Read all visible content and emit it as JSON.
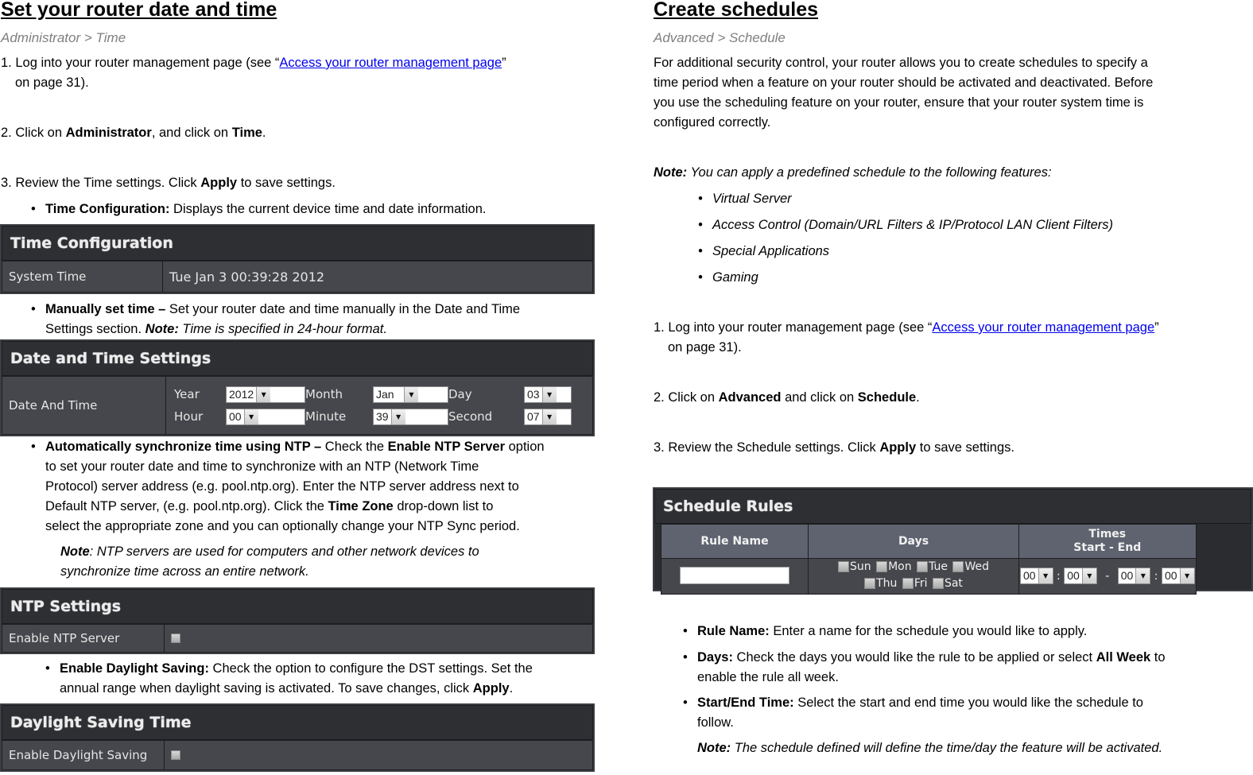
{
  "left": {
    "title": "Set your router date and time",
    "breadcrumb": "Administrator > Time",
    "step1": {
      "prefix": "1. Log into your router management page (see “",
      "link": "Access your router management page",
      "suffix": "”",
      "line2": "on page 31)."
    },
    "step2": {
      "prefix": "2. Click on ",
      "b1": "Administrator",
      "mid": ", and click on ",
      "b2": "Time",
      "suffix": "."
    },
    "step3": {
      "prefix": "3. Review the Time settings. Click ",
      "b": "Apply",
      "suffix": " to save settings."
    },
    "bullet_time_config": {
      "b": "Time Configuration:",
      "text": " Displays the current device time and date information."
    },
    "time_config_panel": {
      "title": "Time Configuration",
      "label": "System Time",
      "value": "Tue Jan 3 00:39:28 2012"
    },
    "bullet_manual": {
      "b": "Manually set time –",
      "text": " Set your router date and time manually in the Date and Time",
      "line2": "Settings section. ",
      "note_b": "Note:",
      "note_i": " Time is specified in 24-hour format."
    },
    "date_time_panel": {
      "title": "Date and Time Settings",
      "label": "Date And Time",
      "fields": [
        {
          "label": "Year",
          "value": "2012"
        },
        {
          "label": "Month",
          "value": "Jan"
        },
        {
          "label": "Day",
          "value": "03"
        },
        {
          "label": "Hour",
          "value": "00"
        },
        {
          "label": "Minute",
          "value": "39"
        },
        {
          "label": "Second",
          "value": "07"
        }
      ]
    },
    "bullet_ntp": {
      "b": "Automatically synchronize time using NTP –",
      "t1": " Check the ",
      "b2": "Enable NTP Server",
      "t2": " option",
      "line2": "to set your router date and time to synchronize with an NTP (Network Time",
      "line3": "Protocol) server address (e.g. pool.ntp.org). Enter the NTP server address next to",
      "line4a": "Default NTP server, (e.g. pool.ntp.org). Click the ",
      "line4b": "Time Zone",
      "line4c": " drop-down list to",
      "line5": "select the appropriate zone and you can optionally change your NTP Sync period.",
      "note_b": "Note",
      "note_i1": ":  NTP servers are used for computers and other network devices to",
      "note_i2": "synchronize time across an entire network."
    },
    "ntp_panel": {
      "title": "NTP Settings",
      "label": "Enable NTP Server",
      "checked": false
    },
    "bullet_dst": {
      "b": "Enable Daylight Saving:",
      "text": " Check the option to configure the DST settings. Set the",
      "line2a": "annual range when daylight saving is activated. To save changes, click ",
      "line2b": "Apply",
      "line2c": "."
    },
    "dst_panel": {
      "title": "Daylight Saving Time",
      "label": "Enable Daylight Saving",
      "checked": false
    }
  },
  "right": {
    "title": "Create schedules",
    "breadcrumb": "Advanced > Schedule",
    "intro": [
      "For additional security control, your router allows you to create schedules to specify a",
      "time period when a feature on your router should be activated and deactivated. Before",
      "you use the scheduling feature on your router, ensure that your router system time is",
      "configured correctly."
    ],
    "note": {
      "b": "Note:",
      "i": " You can apply a predefined schedule to the following features:"
    },
    "features": [
      "Virtual Server",
      "Access Control (Domain/URL Filters & IP/Protocol LAN Client Filters)",
      "Special Applications",
      "Gaming"
    ],
    "step1": {
      "prefix": "1. Log into your router management page (see “",
      "link": "Access your router management page",
      "suffix": "”",
      "line2": "on page 31)."
    },
    "step2": {
      "prefix": "2. Click on ",
      "b1": "Advanced",
      "mid": " and click on ",
      "b2": "Schedule",
      "suffix": "."
    },
    "step3": {
      "prefix": "3. Review the Schedule settings. Click ",
      "b": "Apply",
      "suffix": " to save settings."
    },
    "schedule_panel": {
      "title": "Schedule Rules",
      "headers": {
        "rule_name": "Rule Name",
        "days": "Days",
        "times_line1": "Times",
        "times_line2": "Start - End"
      },
      "rule_name_value": "",
      "days": [
        "Sun",
        "Mon",
        "Tue",
        "Wed",
        "Thu",
        "Fri",
        "Sat"
      ],
      "times": {
        "start_hour": "00",
        "start_min": "00",
        "separator": "-",
        "end_hour": "00",
        "end_min": "00",
        "colon": ":"
      }
    },
    "bullets": [
      {
        "b": "Rule Name:",
        "text": " Enter a name for the schedule you would like to apply."
      },
      {
        "b": "Days:",
        "text": " Check the days you would like the rule to be applied or select ",
        "b2": "All Week",
        "text2": " to",
        "line2": "enable the rule all week."
      },
      {
        "b": "Start/End Time:",
        "text": " Select the start and end time you would like the schedule to",
        "line2": "follow."
      }
    ],
    "final_note": {
      "b": "Note:",
      "i": " The schedule defined will define the time/day the feature will be activated."
    }
  }
}
